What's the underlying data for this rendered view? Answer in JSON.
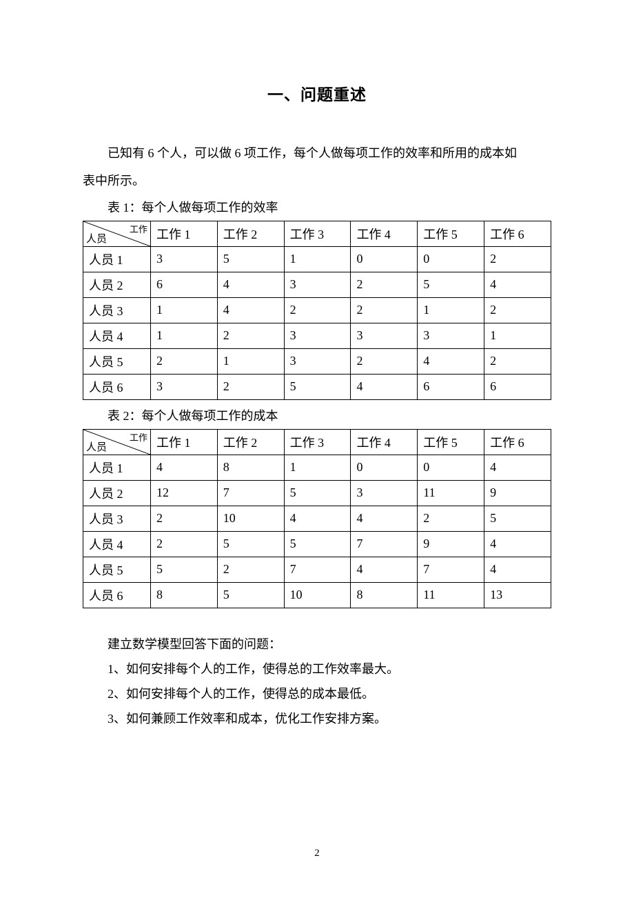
{
  "title": "一、问题重述",
  "intro_line1": "已知有 6 个人，可以做 6 项工作，每个人做每项工作的效率和所用的成本如",
  "intro_line2": "表中所示。",
  "table1": {
    "caption": "表 1：每个人做每项工作的效率",
    "diag_top": "工作",
    "diag_bottom": "人员",
    "cols": [
      "工作 1",
      "工作 2",
      "工作 3",
      "工作 4",
      "工作 5",
      "工作 6"
    ],
    "rows": [
      {
        "label": "人员 1",
        "cells": [
          "3",
          "5",
          "1",
          "0",
          "0",
          "2"
        ]
      },
      {
        "label": "人员 2",
        "cells": [
          "6",
          "4",
          "3",
          "2",
          "5",
          "4"
        ]
      },
      {
        "label": "人员 3",
        "cells": [
          "1",
          "4",
          "2",
          "2",
          "1",
          "2"
        ]
      },
      {
        "label": "人员 4",
        "cells": [
          "1",
          "2",
          "3",
          "3",
          "3",
          "1"
        ]
      },
      {
        "label": "人员 5",
        "cells": [
          "2",
          "1",
          "3",
          "2",
          "4",
          "2"
        ]
      },
      {
        "label": "人员 6",
        "cells": [
          "3",
          "2",
          "5",
          "4",
          "6",
          "6"
        ]
      }
    ]
  },
  "table2": {
    "caption": "表 2：每个人做每项工作的成本",
    "diag_top": "工作",
    "diag_bottom": "人员",
    "cols": [
      "工作 1",
      "工作 2",
      "工作 3",
      "工作 4",
      "工作 5",
      "工作 6"
    ],
    "rows": [
      {
        "label": "人员 1",
        "cells": [
          "4",
          "8",
          "1",
          "0",
          "0",
          "4"
        ]
      },
      {
        "label": "人员 2",
        "cells": [
          "12",
          "7",
          "5",
          "3",
          "11",
          "9"
        ]
      },
      {
        "label": "人员 3",
        "cells": [
          "2",
          "10",
          "4",
          "4",
          "2",
          "5"
        ]
      },
      {
        "label": "人员 4",
        "cells": [
          "2",
          "5",
          "5",
          "7",
          "9",
          "4"
        ]
      },
      {
        "label": "人员 5",
        "cells": [
          "5",
          "2",
          "7",
          "4",
          "7",
          "4"
        ]
      },
      {
        "label": "人员 6",
        "cells": [
          "8",
          "5",
          "10",
          "8",
          "11",
          "13"
        ]
      }
    ]
  },
  "questions": {
    "intro": "建立数学模型回答下面的问题：",
    "items": [
      "1、如何安排每个人的工作，使得总的工作效率最大。",
      "2、如何安排每个人的工作，使得总的成本最低。",
      "3、如何兼顾工作效率和成本，优化工作安排方案。"
    ]
  },
  "page_number": "2"
}
